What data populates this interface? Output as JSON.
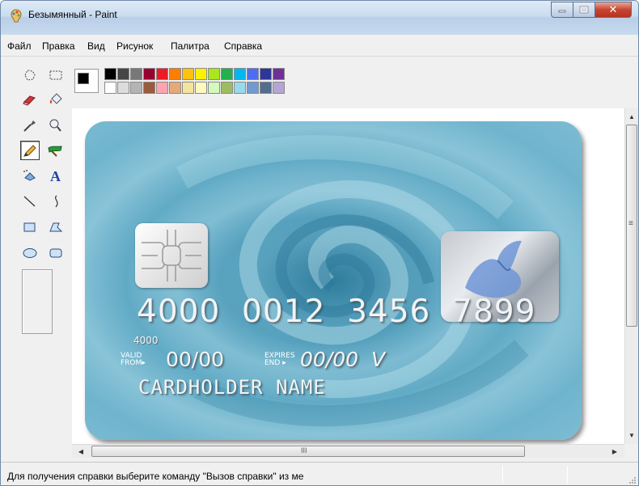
{
  "window": {
    "title": "Безымянный - Paint"
  },
  "menu": {
    "items": [
      "Файл",
      "Правка",
      "Вид",
      "Рисунок",
      "Палитра",
      "Справка"
    ]
  },
  "tools": [
    {
      "name": "free-select"
    },
    {
      "name": "rect-select"
    },
    {
      "name": "eraser"
    },
    {
      "name": "fill"
    },
    {
      "name": "color-picker"
    },
    {
      "name": "magnifier"
    },
    {
      "name": "pencil",
      "active": true
    },
    {
      "name": "brush"
    },
    {
      "name": "airbrush"
    },
    {
      "name": "text"
    },
    {
      "name": "line"
    },
    {
      "name": "curve"
    },
    {
      "name": "rectangle"
    },
    {
      "name": "polygon"
    },
    {
      "name": "ellipse"
    },
    {
      "name": "rounded-rectangle"
    }
  ],
  "palette": {
    "foreground": "#000000",
    "background": "#ffffff",
    "row1": [
      "#000000",
      "#464646",
      "#787878",
      "#990030",
      "#ed1c24",
      "#ff7e00",
      "#ffc20e",
      "#fff200",
      "#a8e61d",
      "#22b14c",
      "#00b7ef",
      "#4d6df3",
      "#2f3699",
      "#6f3198"
    ],
    "row2": [
      "#ffffff",
      "#dcdcdc",
      "#b4b4b4",
      "#9c5a3c",
      "#ffa3b1",
      "#e5aa7a",
      "#f5e49c",
      "#fff9bd",
      "#d3f9bc",
      "#9dbb61",
      "#99d9ea",
      "#709ad1",
      "#546d8e",
      "#b5a5d5"
    ]
  },
  "card": {
    "number": "4000  0012  3456  7899",
    "number_small": "4000",
    "valid_from_label": "VALID\nFROM▸",
    "valid_from_date": "00/00",
    "expires_label": "EXPIRES\nEND ▸",
    "expires_date": "00/00  V",
    "cardholder": "CARDHOLDER NAME"
  },
  "scroll": {
    "h_thumb_marker": "III",
    "v_thumb_marker": "≡"
  },
  "status": {
    "text": "Для получения справки выберите команду \"Вызов справки\" из ме"
  }
}
